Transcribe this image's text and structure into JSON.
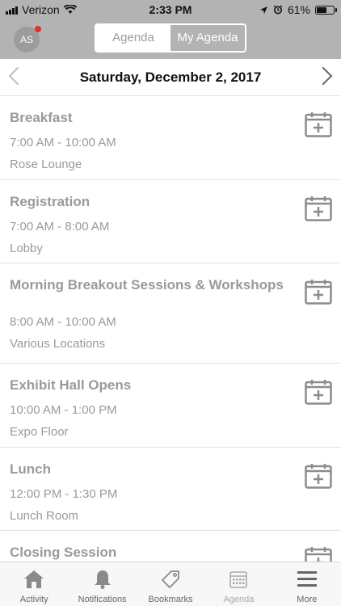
{
  "status_bar": {
    "carrier": "Verizon",
    "time": "2:33 PM",
    "battery_percent": "61%",
    "battery_level": 0.61
  },
  "header": {
    "avatar_initials": "AS",
    "tabs": [
      {
        "label": "Agenda",
        "selected": false
      },
      {
        "label": "My Agenda",
        "selected": true
      }
    ]
  },
  "date_nav": {
    "date": "Saturday, December 2, 2017"
  },
  "sessions": [
    {
      "title": "Breakfast",
      "time": "7:00 AM - 10:00 AM",
      "location": "Rose Lounge"
    },
    {
      "title": "Registration",
      "time": "7:00 AM - 8:00 AM",
      "location": "Lobby"
    },
    {
      "title": "Morning Breakout Sessions & Workshops",
      "time": "8:00 AM - 10:00 AM",
      "location": "Various Locations"
    },
    {
      "title": "Exhibit Hall Opens",
      "time": "10:00 AM - 1:00 PM",
      "location": "Expo Floor"
    },
    {
      "title": "Lunch",
      "time": "12:00 PM - 1:30 PM",
      "location": "Lunch Room"
    },
    {
      "title": "Closing Session",
      "time": "",
      "location": ""
    }
  ],
  "tab_bar": [
    {
      "label": "Activity",
      "icon": "home-icon"
    },
    {
      "label": "Notifications",
      "icon": "bell-icon"
    },
    {
      "label": "Bookmarks",
      "icon": "tag-icon"
    },
    {
      "label": "Agenda",
      "icon": "calendar-icon"
    },
    {
      "label": "More",
      "icon": "menu-icon"
    }
  ],
  "colors": {
    "header_bg": "#b3b3b3",
    "notification_dot": "#e0332a",
    "text_muted": "#9a9a9a"
  }
}
